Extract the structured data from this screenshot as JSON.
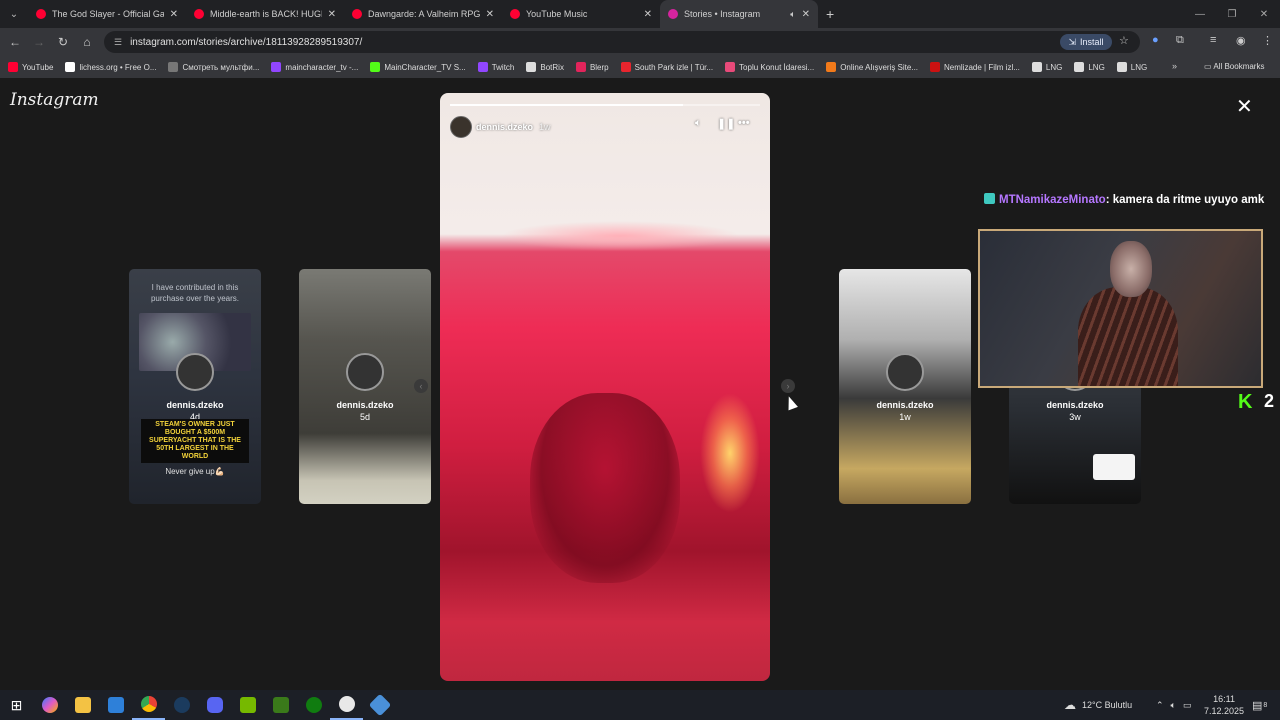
{
  "browser": {
    "tabs": [
      {
        "title": "The God Slayer - Official Gamep",
        "favicon_color": "#ff0033",
        "active": false
      },
      {
        "title": "Middle-earth is BACK! HUGE La",
        "favicon_color": "#ff0033",
        "active": false
      },
      {
        "title": "Dawngarde: A Valheim RPG | O",
        "favicon_color": "#ff0033",
        "active": false
      },
      {
        "title": "YouTube Music",
        "favicon_color": "#ff0033",
        "active": false
      },
      {
        "title": "Stories • Instagram",
        "favicon_color": "#d6249f",
        "active": true
      }
    ],
    "url": "instagram.com/stories/archive/18113928289519307/",
    "install_label": "Install",
    "bookmarks": [
      {
        "label": "YouTube",
        "color": "#ff0033"
      },
      {
        "label": "lichess.org • Free O...",
        "color": "#ffffff"
      },
      {
        "label": "Смотреть мультфи...",
        "color": "#777777"
      },
      {
        "label": "maincharacter_tv -...",
        "color": "#9146ff"
      },
      {
        "label": "MainCharacter_TV S...",
        "color": "#53fc18"
      },
      {
        "label": "Twitch",
        "color": "#9146ff"
      },
      {
        "label": "BotRix",
        "color": "#dddddd"
      },
      {
        "label": "Blerp",
        "color": "#e2245b"
      },
      {
        "label": "South Park izle | Tür...",
        "color": "#e8252e"
      },
      {
        "label": "Toplu Konut İdaresi...",
        "color": "#e84a7a"
      },
      {
        "label": "Online Alışveriş Site...",
        "color": "#f27a1a"
      },
      {
        "label": "Nemlizade | Film izl...",
        "color": "#cc1111"
      },
      {
        "label": "LNG",
        "color": "#dddddd"
      },
      {
        "label": "LNG",
        "color": "#dddddd"
      },
      {
        "label": "LNG",
        "color": "#dddddd"
      }
    ],
    "all_bookmarks": "All Bookmarks"
  },
  "instagram": {
    "logo": "Instagram",
    "story": {
      "username": "dennis.dzeko",
      "time": "1w",
      "progress": 0.75
    },
    "side_cards": [
      {
        "username": "dennis.dzeko",
        "ago": "4d",
        "top_text": "I have contributed in this purchase over the years.",
        "headline": "STEAM'S OWNER JUST BOUGHT A $500M SUPERYACHT THAT IS THE 50TH LARGEST IN THE WORLD",
        "footer": "Never give up💪🏻"
      },
      {
        "username": "dennis.dzeko",
        "ago": "5d"
      },
      {
        "username": "dennis.dzeko",
        "ago": "1w"
      },
      {
        "username": "dennis.dzeko",
        "ago": "3w"
      }
    ]
  },
  "overlay": {
    "chat_user": "MTNamikazeMinato",
    "chat_message": ": kamera da ritme uyuyo amk",
    "kick_count": "2"
  },
  "taskbar": {
    "weather": "12°C Bulutlu",
    "time": "16:11",
    "date": "7.12.2025",
    "notifications": "8"
  }
}
